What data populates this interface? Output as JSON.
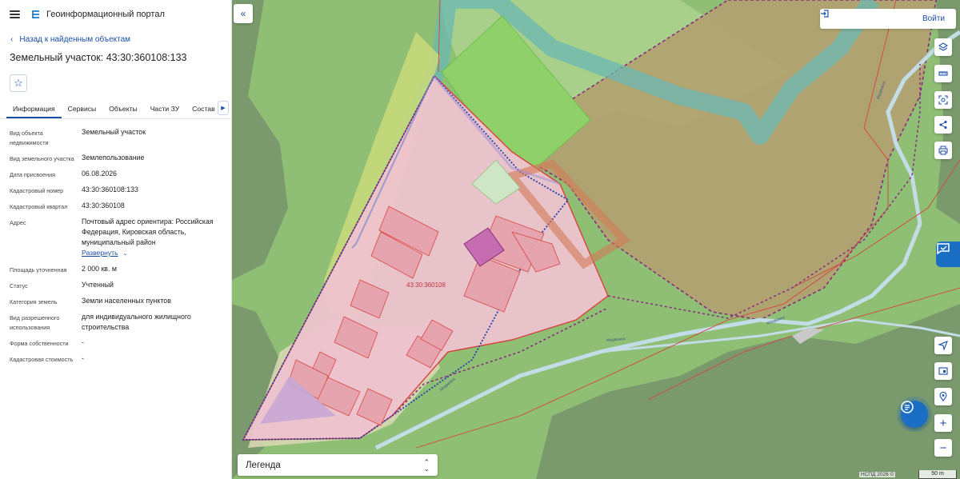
{
  "header": {
    "title": "Геоинформационный портал"
  },
  "panel": {
    "back_label": "Назад к найденным объектам",
    "object_title": "Земельный участок: 43:30:360108:133",
    "tabs": [
      {
        "label": "Информация"
      },
      {
        "label": "Сервисы"
      },
      {
        "label": "Объекты"
      },
      {
        "label": "Части ЗУ"
      },
      {
        "label": "Состав"
      }
    ],
    "properties": [
      {
        "label": "Вид объекта недвижимости",
        "value": "Земельный участок"
      },
      {
        "label": "Вид земельного участка",
        "value": "Землепользование"
      },
      {
        "label": "Дата присвоения",
        "value": "06.08.2026"
      },
      {
        "label": "Кадастровый номер",
        "value": "43:30:360108:133"
      },
      {
        "label": "Кадастровый квартал",
        "value": "43:30:360108"
      },
      {
        "label": "Адрес",
        "value": "Почтовый адрес ориентира: Российская Федерация, Кировская область, муниципальный район"
      },
      {
        "label": "Площадь уточненная",
        "value": "2 000 кв. м"
      },
      {
        "label": "Статус",
        "value": "Учтенный"
      },
      {
        "label": "Категория земель",
        "value": "Земли населенных пунктов"
      },
      {
        "label": "Вид разрешенного использования",
        "value": "для индивидуального жилищного строительства"
      },
      {
        "label": "Форма собственности",
        "value": "-"
      },
      {
        "label": "Кадастровая стоимость",
        "value": "-"
      }
    ],
    "expand_label": "Развернуть"
  },
  "map": {
    "login_label": "Войти",
    "quarter_label": "43:30:360108",
    "river_labels": [
      "Медвежка",
      "Медвежка",
      "Медвежка",
      "Медвежка"
    ],
    "legend_label": "Легенда",
    "attribution": "НСПД 2026 ©",
    "scale_label": "50 m",
    "icons": [
      "layers-icon",
      "ruler-icon",
      "select-area-icon",
      "share-icon",
      "print-icon",
      "locate-arrow-icon",
      "minimap-icon",
      "pin-icon",
      "zoom-in-icon",
      "zoom-out-icon",
      "chat-icon"
    ],
    "colors": {
      "accent": "#1a4fa8",
      "parcel_fill": "#eec3cf",
      "border_red": "#d9403c",
      "forest": "#7a9a6d",
      "field": "#8fbe75"
    }
  }
}
